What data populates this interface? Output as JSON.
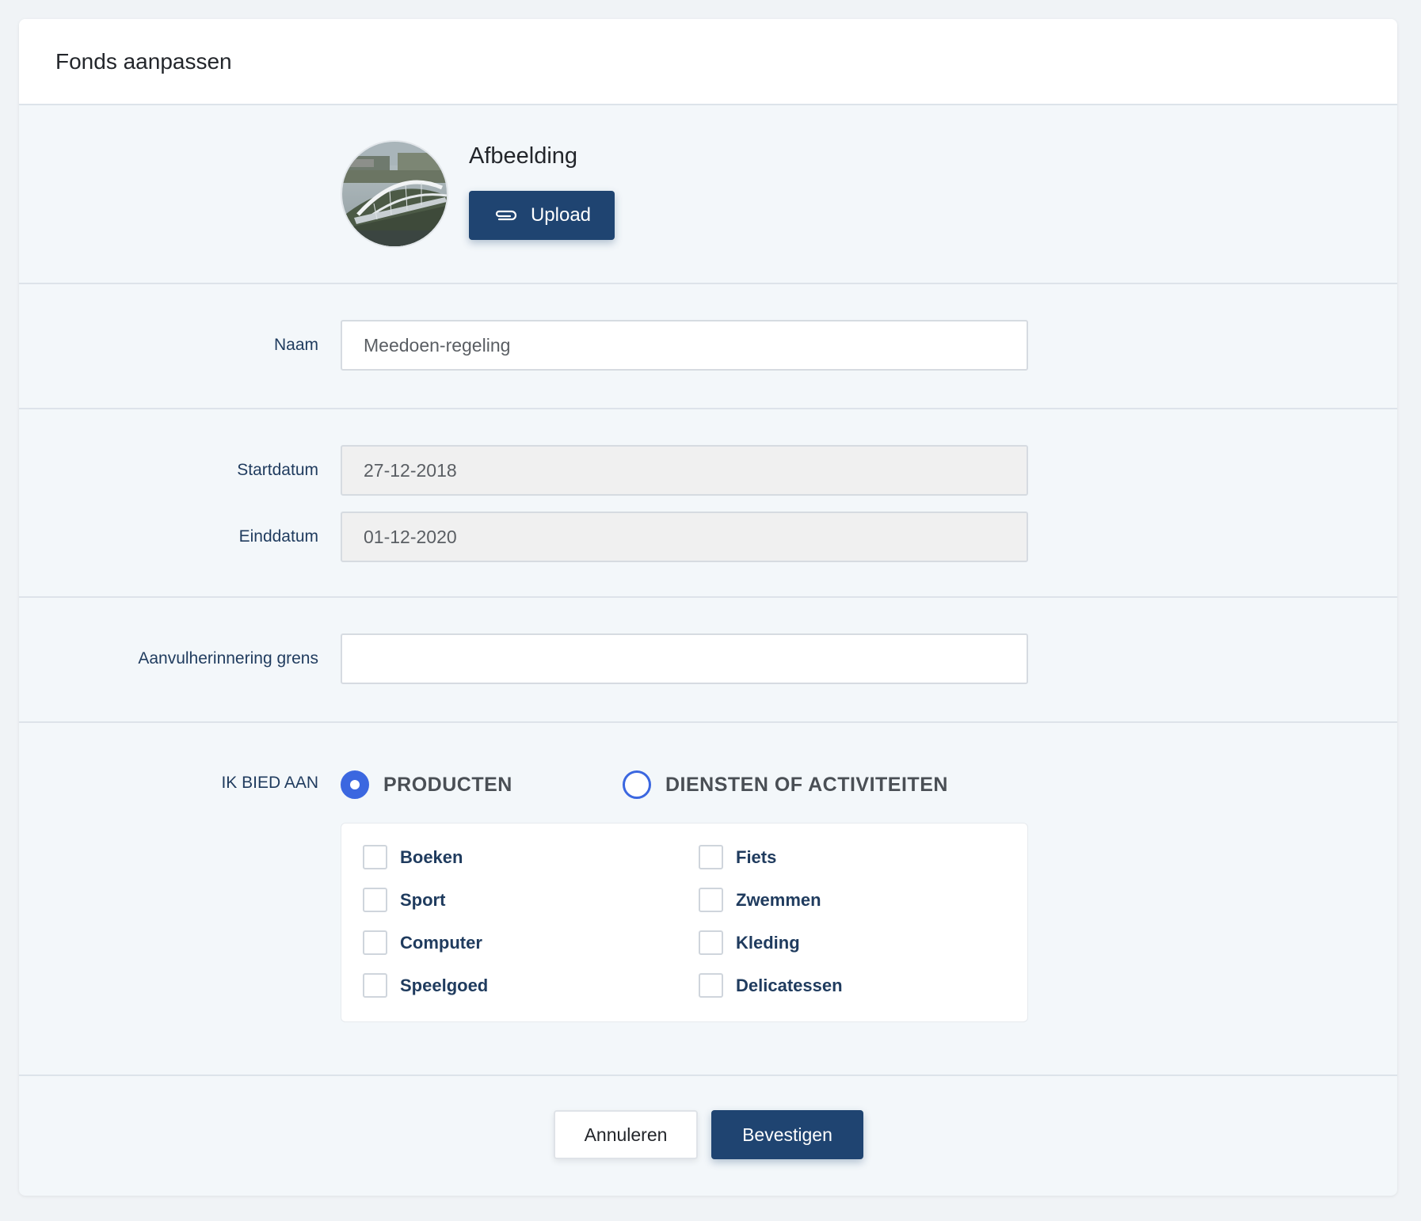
{
  "header": {
    "title": "Fonds aanpassen"
  },
  "image_section": {
    "title": "Afbeelding",
    "upload_label": "Upload",
    "upload_icon": "paperclip-icon"
  },
  "name_field": {
    "label": "Naam",
    "value": "Meedoen-regeling"
  },
  "start_date": {
    "label": "Startdatum",
    "value": "27-12-2018"
  },
  "end_date": {
    "label": "Einddatum",
    "value": "01-12-2020"
  },
  "reminder_field": {
    "label": "Aanvulherinnering grens",
    "value": ""
  },
  "offer": {
    "label": "IK BIED AAN",
    "options": [
      {
        "label": "PRODUCTEN",
        "selected": true
      },
      {
        "label": "DIENSTEN OF ACTIVITEITEN",
        "selected": false
      }
    ],
    "categories": [
      {
        "label": "Boeken",
        "checked": false
      },
      {
        "label": "Fiets",
        "checked": false
      },
      {
        "label": "Sport",
        "checked": false
      },
      {
        "label": "Zwemmen",
        "checked": false
      },
      {
        "label": "Computer",
        "checked": false
      },
      {
        "label": "Kleding",
        "checked": false
      },
      {
        "label": "Speelgoed",
        "checked": false
      },
      {
        "label": "Delicatessen",
        "checked": false
      }
    ]
  },
  "actions": {
    "cancel_label": "Annuleren",
    "confirm_label": "Bevestigen"
  },
  "colors": {
    "primary": "#1f4471",
    "radio_accent": "#3b67e0",
    "label_text": "#1f3b5e"
  }
}
